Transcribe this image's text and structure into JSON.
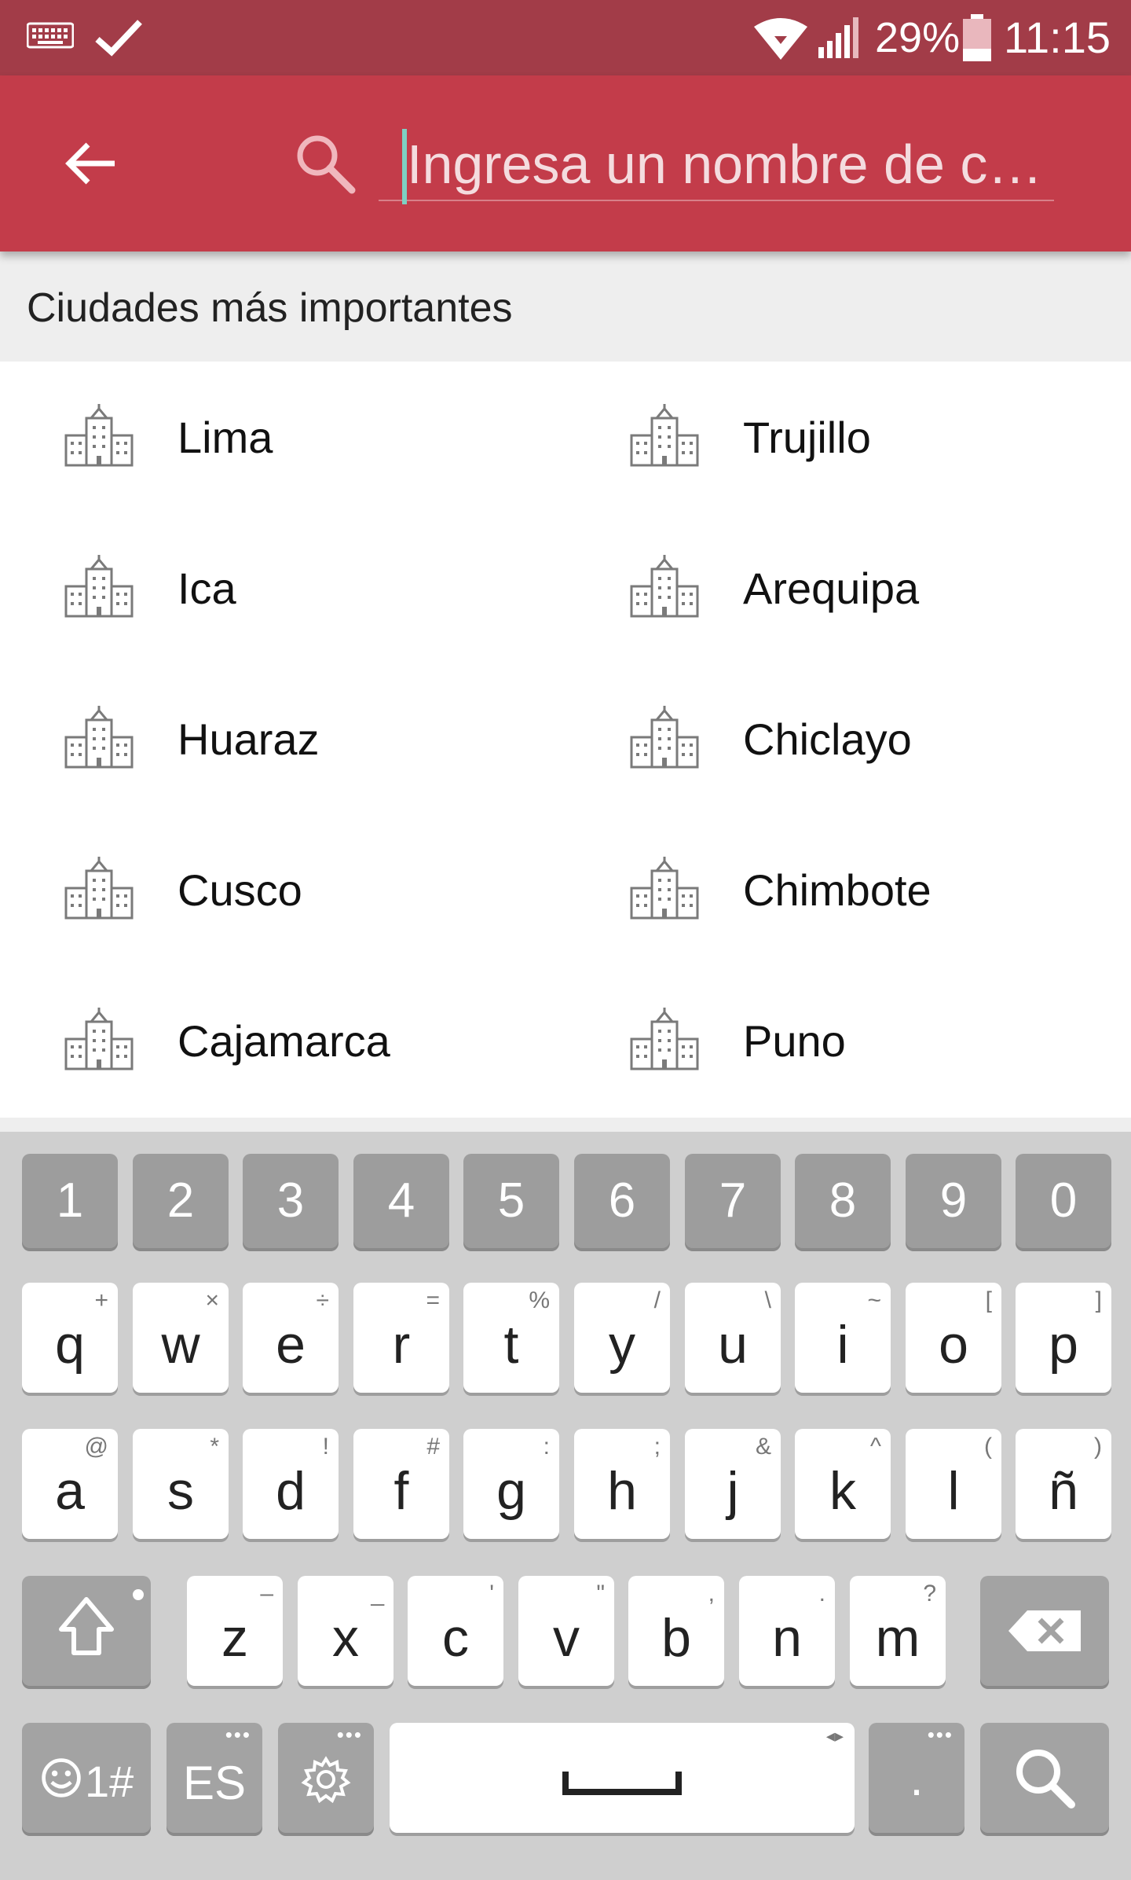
{
  "status_bar": {
    "battery_percent": "29%",
    "time": "11:15",
    "icons": [
      "keyboard-icon",
      "check-icon",
      "wifi-icon",
      "signal-icon",
      "battery-icon"
    ]
  },
  "app_bar": {
    "search_placeholder": "Ingresa un nombre de c…",
    "colors": {
      "status_bar": "#a23c48",
      "app_bar": "#c33c4a",
      "cursor": "#7ecfc2"
    }
  },
  "section": {
    "title": "Ciudades más importantes"
  },
  "cities": [
    "Lima",
    "Trujillo",
    "Ica",
    "Arequipa",
    "Huaraz",
    "Chiclayo",
    "Cusco",
    "Chimbote",
    "Cajamarca",
    "Puno"
  ],
  "keyboard": {
    "number_row": [
      "1",
      "2",
      "3",
      "4",
      "5",
      "6",
      "7",
      "8",
      "9",
      "0"
    ],
    "row1": [
      {
        "k": "q",
        "alt": "+"
      },
      {
        "k": "w",
        "alt": "×"
      },
      {
        "k": "e",
        "alt": "÷"
      },
      {
        "k": "r",
        "alt": "="
      },
      {
        "k": "t",
        "alt": "%"
      },
      {
        "k": "y",
        "alt": "/"
      },
      {
        "k": "u",
        "alt": "\\"
      },
      {
        "k": "i",
        "alt": "~"
      },
      {
        "k": "o",
        "alt": "["
      },
      {
        "k": "p",
        "alt": "]"
      }
    ],
    "row2": [
      {
        "k": "a",
        "alt": "@"
      },
      {
        "k": "s",
        "alt": "*"
      },
      {
        "k": "d",
        "alt": "!"
      },
      {
        "k": "f",
        "alt": "#"
      },
      {
        "k": "g",
        "alt": ":"
      },
      {
        "k": "h",
        "alt": ";"
      },
      {
        "k": "j",
        "alt": "&"
      },
      {
        "k": "k",
        "alt": "^"
      },
      {
        "k": "l",
        "alt": "("
      },
      {
        "k": "ñ",
        "alt": ")"
      }
    ],
    "row3": [
      {
        "k": "z",
        "alt": "–"
      },
      {
        "k": "x",
        "alt": "_"
      },
      {
        "k": "c",
        "alt": "'"
      },
      {
        "k": "v",
        "alt": "\""
      },
      {
        "k": "b",
        "alt": ","
      },
      {
        "k": "n",
        "alt": "."
      },
      {
        "k": "m",
        "alt": "?"
      }
    ],
    "symbols_label": "1#",
    "language_label": "ES",
    "period_label": "."
  }
}
